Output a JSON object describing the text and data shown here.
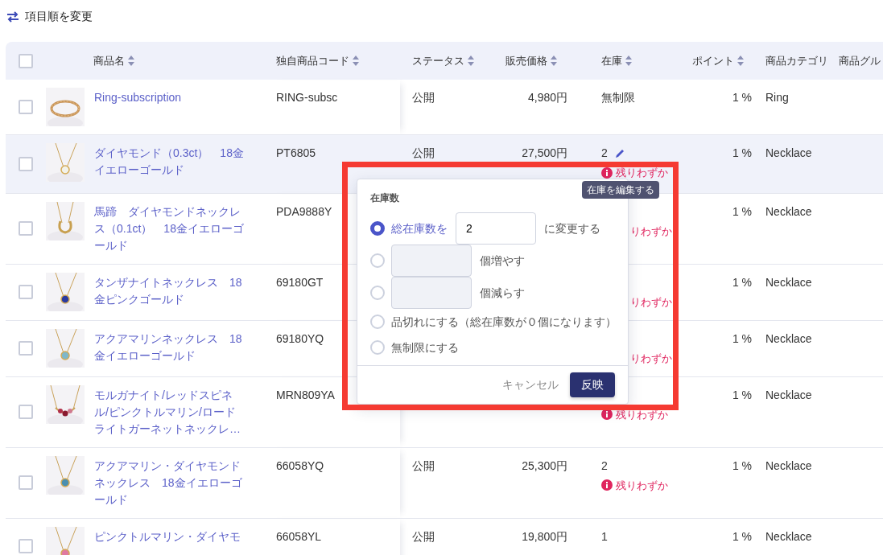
{
  "reorder_link": "項目順を変更",
  "header_checkbox": {
    "checked": false
  },
  "columns": [
    {
      "label": "商品名",
      "sortable": true
    },
    {
      "label": "独自商品コード",
      "sortable": true
    },
    {
      "label": "ステータス",
      "sortable": true
    },
    {
      "label": "販売価格",
      "sortable": true
    },
    {
      "label": "在庫",
      "sortable": true
    },
    {
      "label": "ポイント",
      "sortable": true
    },
    {
      "label": "商品カテゴリ",
      "sortable": false
    },
    {
      "label": "商品グル",
      "sortable": false
    }
  ],
  "rows": [
    {
      "checked": false,
      "hovered": false,
      "name": "Ring-subscription",
      "code": "RING-subsc",
      "status": "公開",
      "price": "4,980円",
      "stock": "無制限",
      "editable": false,
      "point": "1 %",
      "category": "Ring"
    },
    {
      "checked": false,
      "hovered": true,
      "name": "ダイヤモンド（0.3ct）　18金イエローゴールド",
      "code": "PT6805",
      "status": "公開",
      "price": "27,500円",
      "stock": "2",
      "editable": true,
      "low_stock": "残りわずか",
      "point": "1 %",
      "category": "Necklace"
    },
    {
      "checked": false,
      "hovered": false,
      "name": "馬蹄　ダイヤモンドネックレス（0.1ct）　18金イエローゴールド",
      "code": "PDA9888Y",
      "low_stock": "りわずか",
      "point": "1 %",
      "category": "Necklace"
    },
    {
      "checked": false,
      "hovered": false,
      "name": "タンザナイトネックレス　18金ピンクゴールド",
      "code": "69180GT",
      "low_stock": "りわずか",
      "point": "1 %",
      "category": "Necklace"
    },
    {
      "checked": false,
      "hovered": false,
      "name": "アクアマリンネックレス　18金イエローゴールド",
      "code": "69180YQ",
      "low_stock": "りわずか",
      "point": "1 %",
      "category": "Necklace"
    },
    {
      "checked": false,
      "hovered": false,
      "name": "モルガナイト/レッドスピネル/ピンクトルマリン/ロードライトガーネットネックレ…",
      "code": "MRN809YA",
      "low_stock": "残りわずか",
      "point": "1 %",
      "category": "Necklace"
    },
    {
      "checked": false,
      "hovered": false,
      "name": "アクアマリン・ダイヤモンドネックレス　18金イエローゴールド",
      "code": "66058YQ",
      "status": "公開",
      "price": "25,300円",
      "stock": "2",
      "editable": false,
      "low_stock": "残りわずか",
      "point": "1 %",
      "category": "Necklace"
    },
    {
      "checked": false,
      "hovered": false,
      "name": "ピンクトルマリン・ダイヤモ",
      "code": "66058YL",
      "status": "公開",
      "price": "19,800円",
      "stock": "1",
      "editable": false,
      "point": "1 %",
      "category": "Necklace"
    }
  ],
  "tooltip": "在庫を編集する",
  "stock_popover": {
    "title": "在庫数",
    "options": [
      {
        "kind": "set",
        "selected": true,
        "label": "総在庫数を",
        "value": "2",
        "suffix": "に変更する"
      },
      {
        "kind": "increase",
        "selected": false,
        "suffix": "個増やす"
      },
      {
        "kind": "decrease",
        "selected": false,
        "suffix": "個減らす"
      },
      {
        "kind": "plain",
        "selected": false,
        "label": "品切れにする（総在庫数が０個になります）"
      },
      {
        "kind": "plain",
        "selected": false,
        "label": "無制限にする"
      }
    ],
    "cancel": "キャンセル",
    "apply": "反映"
  },
  "annotation": {
    "kind": "highlight-frame",
    "color": "#f53a32"
  }
}
